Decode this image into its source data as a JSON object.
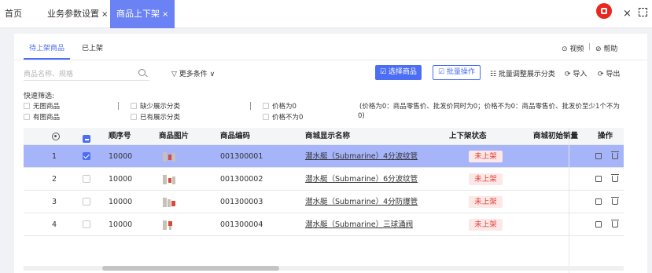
{
  "tabs": {
    "home": "首页",
    "business_params": "业务参数设置",
    "listing": "商品上下架",
    "close": "×"
  },
  "window": {
    "close": "×"
  },
  "subtabs": {
    "pending": "待上架商品",
    "listed": "已上架"
  },
  "help": {
    "video": "⊙ 视频",
    "sep": "|",
    "help": "⊘ 帮助"
  },
  "search": {
    "placeholder": "商品名称、规格",
    "more_filters": "▽ 更多条件 ∨"
  },
  "toolbar": {
    "select_goods": "☑ 选择商品",
    "batch_ops": "☑ 批量操作",
    "batch_adjust": "☷ 批量调整展示分类",
    "import": "⟳ 导入",
    "export": "⟳ 导出"
  },
  "quick_filter": {
    "label": "快速筛选:",
    "no_image": "无图商品",
    "has_image": "有图商品",
    "missing_category": "缺少展示分类",
    "has_category": "已有展示分类",
    "price_zero": "价格为0",
    "price_nonzero": "价格不为0",
    "note_line1": "(价格为0：商品零售价、批发价同时为0；价格不为0：商品零售价、批发价至少1个不为",
    "note_line2": "0)"
  },
  "table": {
    "headers": {
      "index": "",
      "check": "",
      "order": "顺序号",
      "image": "商品图片",
      "code": "商品编码",
      "name": "商城显示名称",
      "status": "上下架状态",
      "initial_sales": "商城初始销量",
      "actions": "操作"
    },
    "rows": [
      {
        "index": "1",
        "order": "10000",
        "code": "001300001",
        "name": "潜水艇（Submarine）4分波纹管",
        "status": "未上架",
        "selected": true
      },
      {
        "index": "2",
        "order": "10000",
        "code": "001300002",
        "name": "潜水艇（Submarine）6分波纹管",
        "status": "未上架",
        "selected": false
      },
      {
        "index": "3",
        "order": "10000",
        "code": "001300003",
        "name": "潜水艇（Submarine）4分防爆管",
        "status": "未上架",
        "selected": false
      },
      {
        "index": "4",
        "order": "10000",
        "code": "001300004",
        "name": "潜水艇（Submarine）三球涌阀",
        "status": "未上架",
        "selected": false
      }
    ]
  },
  "colors": {
    "accent": "#4c6ef5",
    "active_tab": "#6b82f5",
    "selected_row": "#a6b4fa",
    "status_red": "#e2443a"
  }
}
